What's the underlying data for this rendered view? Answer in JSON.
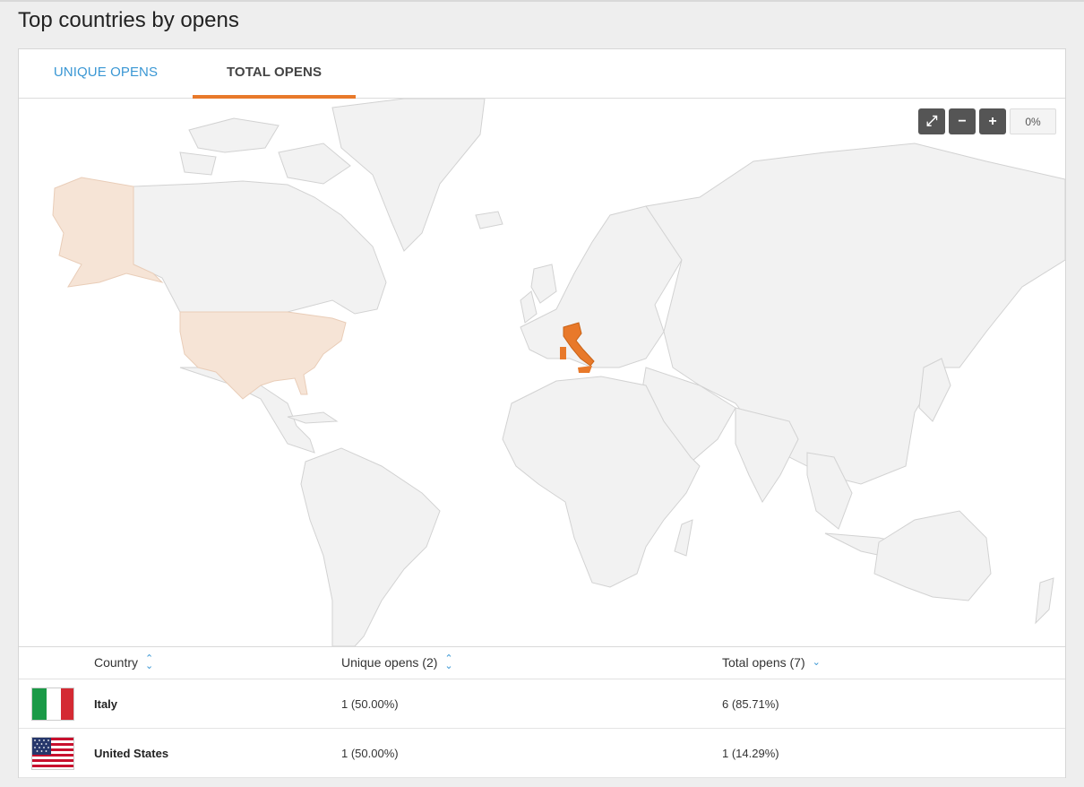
{
  "title": "Top countries by opens",
  "tabs": [
    {
      "label": "UNIQUE OPENS",
      "active": false
    },
    {
      "label": "TOTAL OPENS",
      "active": true
    }
  ],
  "map": {
    "zoom_level": "0%",
    "highlighted": [
      {
        "country": "Italy",
        "color": "#e8792a"
      },
      {
        "country": "United States",
        "color": "#f6e4d6"
      }
    ],
    "land_color": "#f2f2f2",
    "controls": [
      "fit-icon",
      "zoom-out-icon",
      "zoom-in-icon"
    ]
  },
  "table": {
    "headers": {
      "country": "Country",
      "unique": "Unique opens (2)",
      "total": "Total opens (7)"
    },
    "rows": [
      {
        "country": "Italy",
        "unique": "1 (50.00%)",
        "total": "6 (85.71%)",
        "flag": "italy-flag"
      },
      {
        "country": "United States",
        "unique": "1 (50.00%)",
        "total": "1 (14.29%)",
        "flag": "us-flag"
      }
    ]
  },
  "colors": {
    "accent": "#e8792a",
    "link": "#3a97d4"
  }
}
